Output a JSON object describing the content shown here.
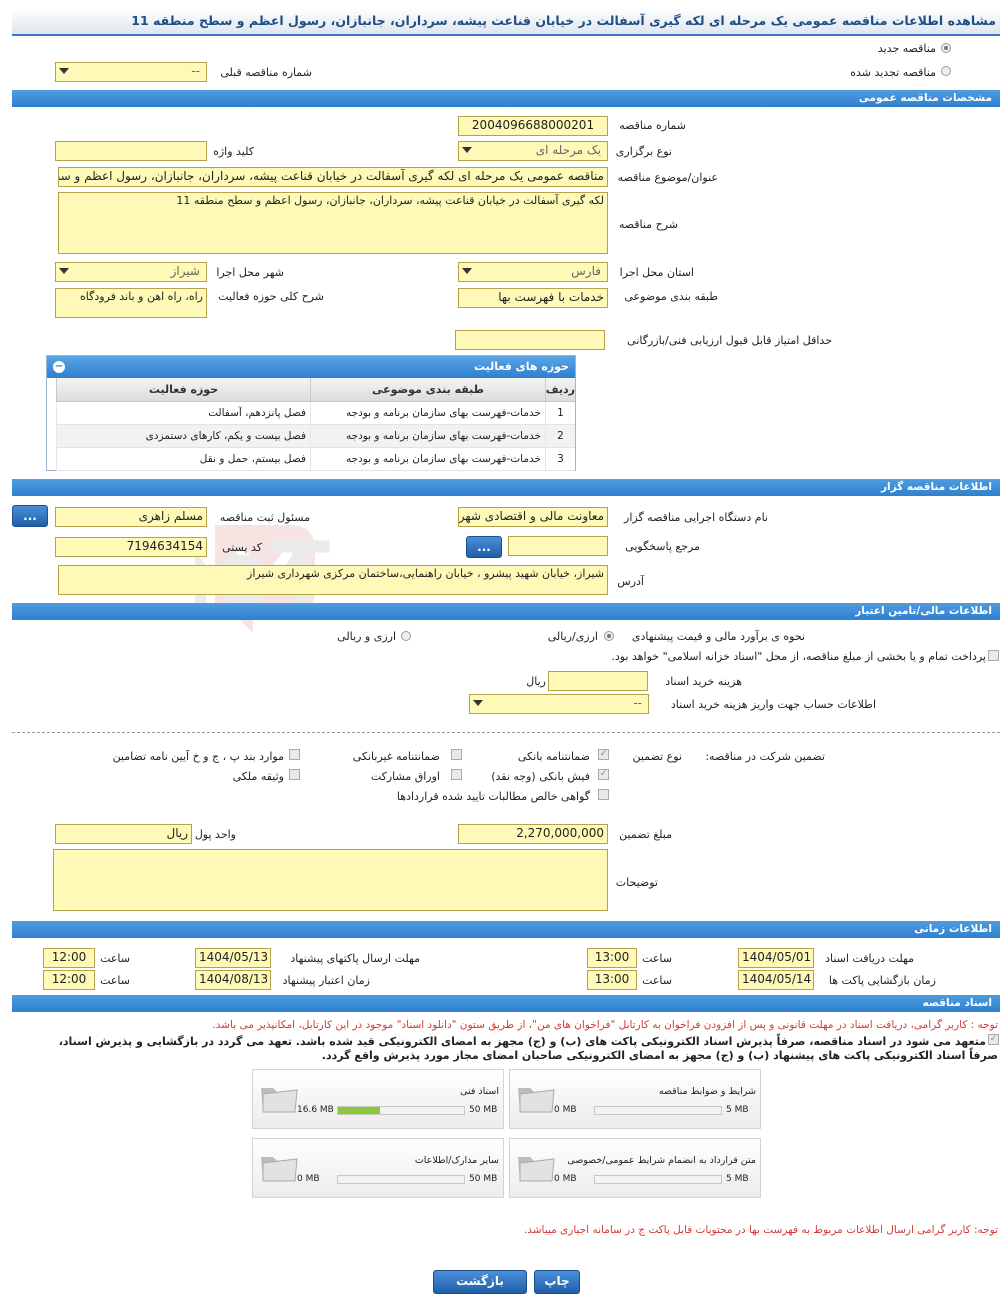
{
  "page_title": "مشاهده اطلاعات مناقصه عمومی یک مرحله ای لکه گیری آسفالت در خیابان قناعت پیشه، سرداران، جانبازان، رسول اعظم و سطح منطقه 11",
  "tender_type": {
    "new_label": "مناقصه جدید",
    "renewed_label": "مناقصه تجدید شده",
    "prev_number_label": "شماره مناقصه قبلی",
    "prev_number_value": "--"
  },
  "watermark_text": "AriaTender.neT",
  "general": {
    "section_title": "مشخصات مناقصه عمومی",
    "number_label": "شماره مناقصه",
    "number_value": "2004096688000201",
    "holding_type_label": "نوع برگزاری",
    "holding_type_value": "یک مرحله ای",
    "keyword_label": "کلید واژه",
    "keyword_value": "",
    "subject_label": "عنوان/موضوع مناقصه",
    "subject_value": "مناقصه عمومی یک مرحله ای لکه گیری آسفالت در خیابان قناعت پیشه، سرداران، جانبازان، رسول اعظم و سطح منطقه 11",
    "description_label": "شرح مناقصه",
    "description_value": "لکه گیری آسفالت در خیابان قناعت پیشه، سرداران، جانبازان، رسول اعظم و سطح منطقه 11",
    "province_label": "استان محل اجرا",
    "province_value": "فارس",
    "city_label": "شهر محل اجرا",
    "city_value": "شیراز",
    "category_label": "طبقه بندی موضوعی",
    "category_value": "خدمات با فهرست بها",
    "activity_scope_label": "شرح کلی حوزه فعالیت",
    "activity_scope_value": "راه، راه اهن و باند فرودگاه",
    "min_score_label": "حداقل امتیاز قابل قبول ارزیابی فنی/بازرگانی",
    "min_score_value": ""
  },
  "activities": {
    "title": "حوزه های فعالیت",
    "toggle": "−",
    "headers": {
      "row": "ردیف",
      "category": "طبقه بندی موضوعی",
      "field": "حوزه فعالیت"
    },
    "rows": [
      {
        "row": "1",
        "category": "خدمات-فهرست بهای سازمان برنامه و بودجه",
        "field": "فصل پانزدهم، آسفالت"
      },
      {
        "row": "2",
        "category": "خدمات-فهرست بهای سازمان برنامه و بودجه",
        "field": "فصل بیست و یکم، کارهای دستمزدی"
      },
      {
        "row": "3",
        "category": "خدمات-فهرست بهای سازمان برنامه و بودجه",
        "field": "فصل بیستم، حمل و نقل"
      }
    ]
  },
  "organizer": {
    "section_title": "اطلاعات مناقصه گزار",
    "org_name_label": "نام دستگاه اجرایی مناقصه گزار",
    "org_name_value": "معاونت مالی و اقتصادی شهرداری شیراز",
    "registrar_label": "مسئول ثبت مناقصه",
    "registrar_value": "مسلم زاهری",
    "more_button": "...",
    "reference_label": "مرجع پاسخگویی",
    "reference_value": "",
    "reference_button": "...",
    "postal_label": "کد پستی",
    "postal_value": "7194634154",
    "address_label": "آدرس",
    "address_value": "شیراز، خیابان شهید پیشرو ، خیابان راهنمایی،ساختمان مرکزی شهرداری شیراز"
  },
  "financial": {
    "section_title": "اطلاعات مالی/تامین اعتبار",
    "estimate_label": "نحوه ی برآورد مالی و قیمت پیشنهادی",
    "opt_currency_rial": "ارزی/ریالی",
    "opt_currency_and_rial": "ارزی و ریالی",
    "treasury_text": "پرداخت تمام و یا بخشی از مبلغ مناقصه، از محل \"اسناد خزانه اسلامی\" خواهد بود.",
    "doc_cost_label": "هزینه خرید اسناد",
    "doc_cost_value": "",
    "doc_cost_unit": "ریال",
    "account_label": "اطلاعات حساب جهت واریز هزینه خرید اسناد",
    "account_value": "--"
  },
  "guarantee": {
    "participation_label": "تضمین شرکت در مناقصه:",
    "type_label": "نوع تضمین",
    "bank_guarantee": "ضمانتنامه بانکی",
    "non_bank_guarantee": "ضمانتنامه غیربانکی",
    "article_items": "موارد بند پ ، ج و خ آیین نامه تضامین",
    "bank_receipt": "فیش بانکی (وجه نقد)",
    "participation_bonds": "اوراق مشارکت",
    "property_collateral": "وثیقه ملکی",
    "net_claims": "گواهی خالص مطالبات تایید شده قراردادها",
    "amount_label": "مبلغ تضمین",
    "amount_value": "2,270,000,000",
    "currency_label": "واحد پول",
    "currency_value": "ریال",
    "notes_label": "توضیحات",
    "notes_value": ""
  },
  "timing": {
    "section_title": "اطلاعات زمانی",
    "doc_receive_label": "مهلت دریافت اسناد",
    "doc_receive_date": "1404/05/01",
    "doc_receive_time": "13:00",
    "send_deadline_label": "مهلت ارسال پاکتهای پیشنهاد",
    "send_deadline_date": "1404/05/13",
    "send_deadline_time": "12:00",
    "opening_label": "زمان بازگشایی پاکت ها",
    "opening_date": "1404/05/14",
    "opening_time": "13:00",
    "validity_label": "زمان اعتبار پیشنهاد",
    "validity_date": "1404/08/13",
    "validity_time": "12:00",
    "time_label": "ساعت"
  },
  "documents": {
    "section_title": "اسناد مناقصه",
    "note_red": "توجه : کاربر گرامی، دریافت اسناد در مهلت قانونی و پس از افزودن فراخوان به کارتابل \"فراخوان های من\"، از طریق ستون \"دانلود اسناد\" موجود در این کارتابل، امکانپذیر می باشد.",
    "note_bold_1": "متعهد می شود در اسناد مناقصه، صرفاً پذیرش اسناد الکترونیکی پاکت های (ب) و (ج) مجهز به امضای الکترونیکی قید شده باشد. تعهد می گردد در بازگشایی و پذیرش اسناد،",
    "note_bold_2": "صرفاً اسناد الکترونیکی پاکت های پیشنهاد (ب) و (ج) مجهز به امضای الکترونیکی صاحبان امضای مجاز مورد پذیرش واقع گردد.",
    "cards": [
      {
        "name": "شرایط و ضوابط مناقصه",
        "current": "0 MB",
        "max": "5 MB",
        "fill": 0
      },
      {
        "name": "اسناد فنی",
        "current": "16.6 MB",
        "max": "50 MB",
        "fill": 0.33
      },
      {
        "name": "متن قرارداد به انضمام شرایط عمومی/خصوصی",
        "current": "0 MB",
        "max": "5 MB",
        "fill": 0
      },
      {
        "name": "سایر مدارک/اطلاعات",
        "current": "0 MB",
        "max": "50 MB",
        "fill": 0
      }
    ],
    "note_bottom": "توجه: کاربر گرامی ارسال اطلاعات مربوط به فهرست بها در محتویات فایل پاکت ج در سامانه اجباری میباشد."
  },
  "buttons": {
    "print": "چاپ",
    "back": "بازگشت"
  }
}
